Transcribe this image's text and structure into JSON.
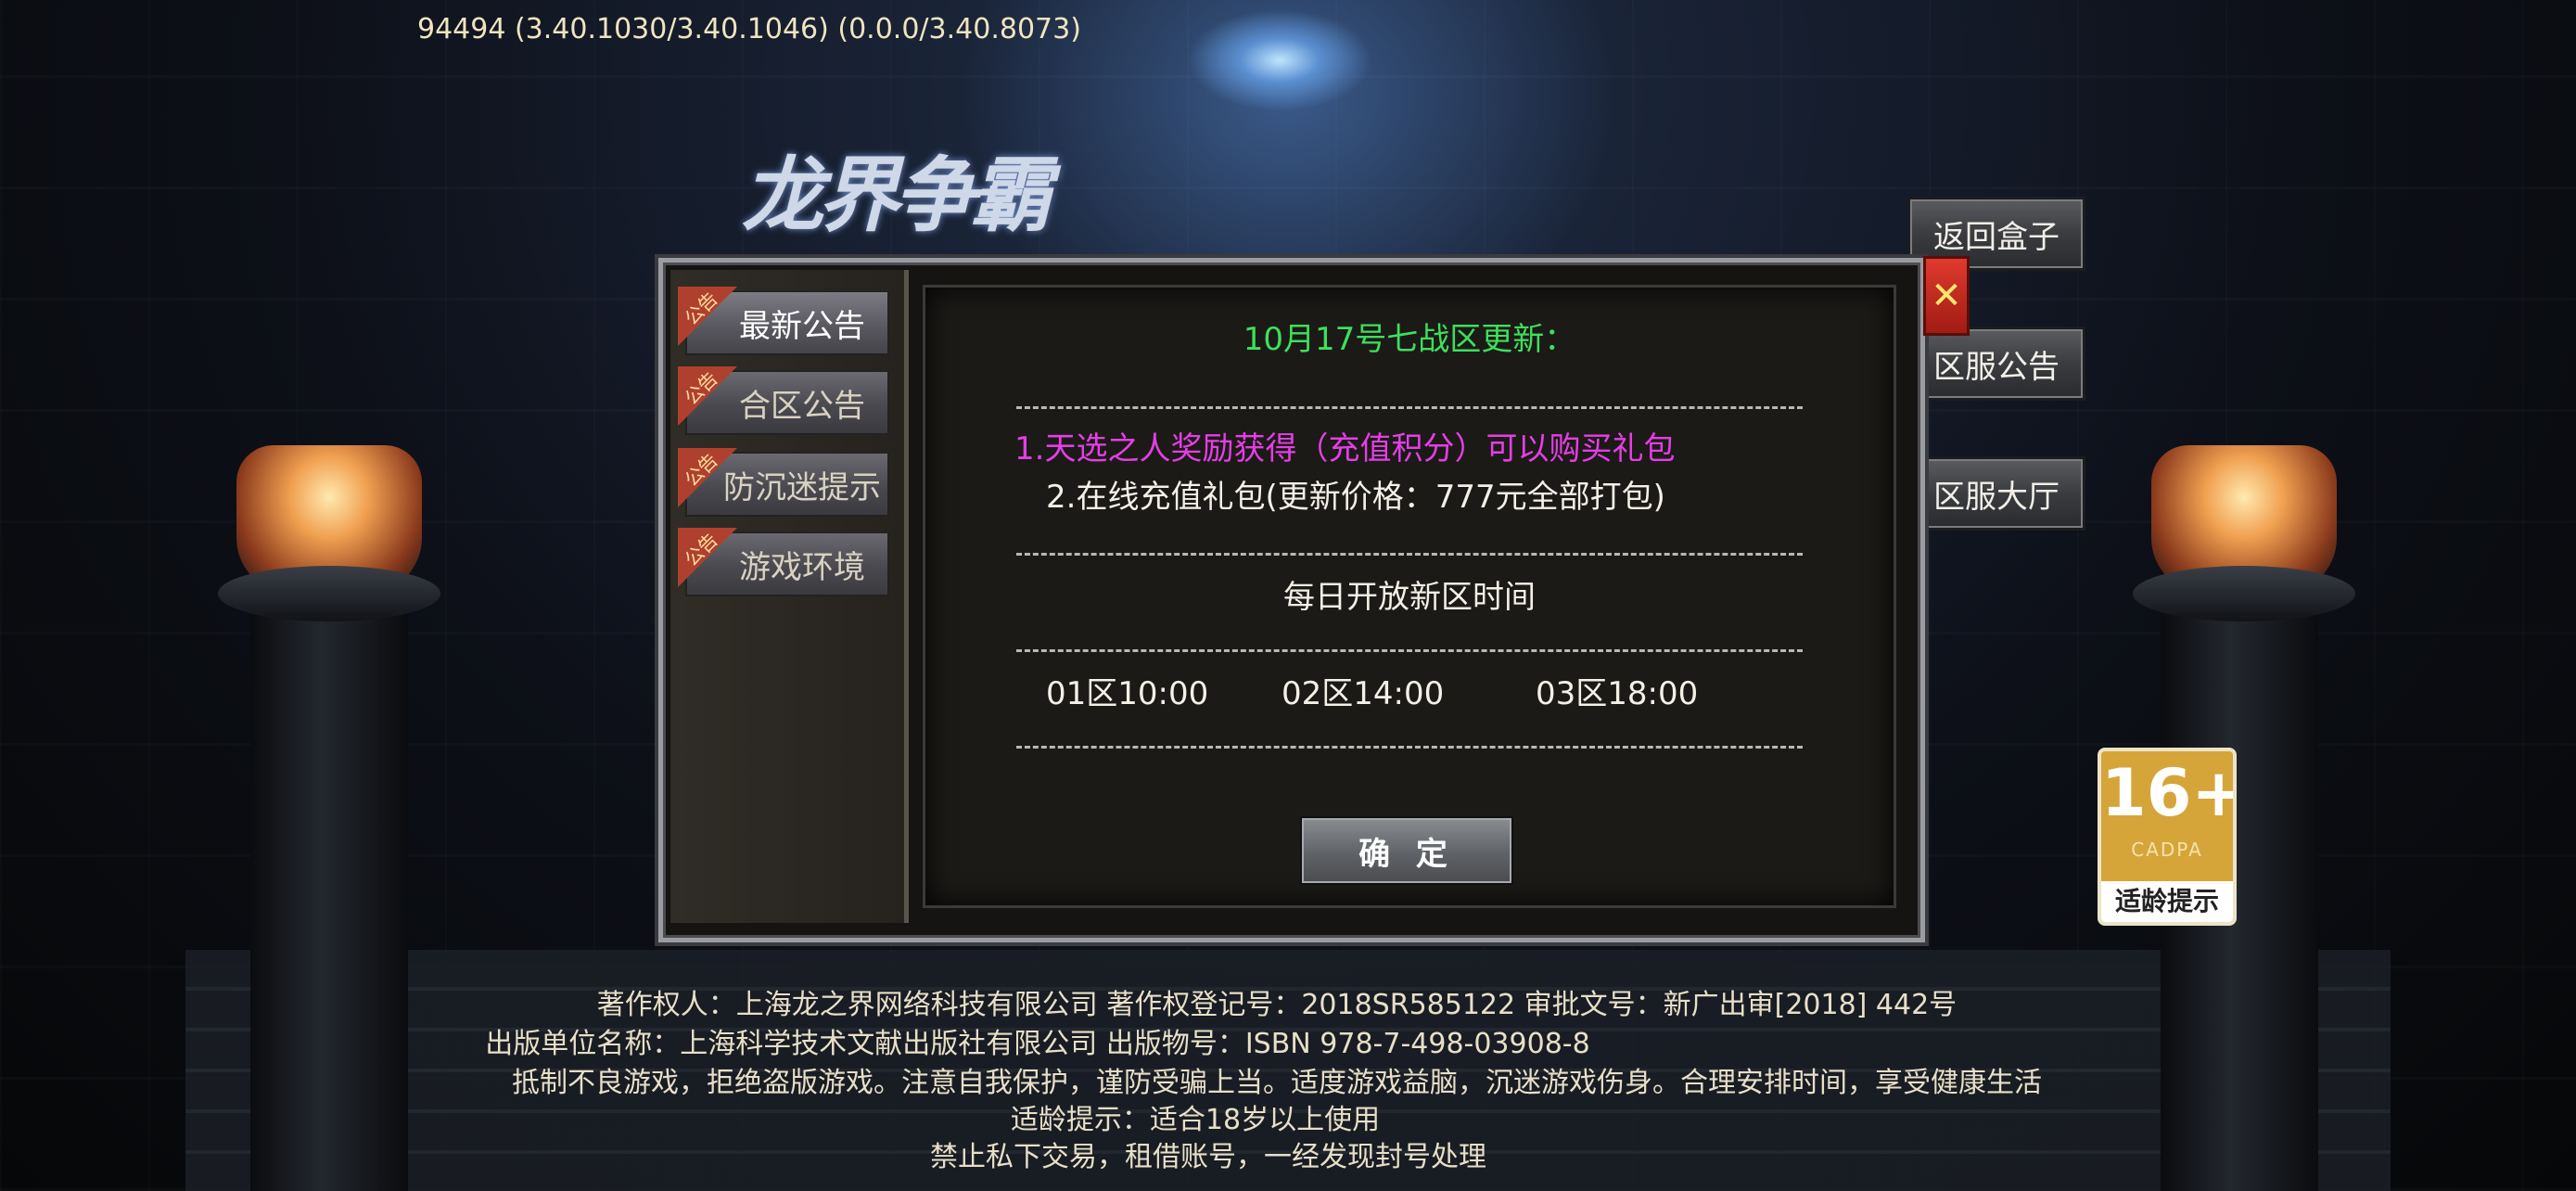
{
  "version": "94494 (3.40.1030/3.40.1046) (0.0.0/3.40.8073)",
  "logo_text": "龙界争霸",
  "side_buttons": {
    "back_to_box": "返回盒子",
    "server_notice": "区服公告",
    "server_hall": "区服大厅"
  },
  "dialog": {
    "ribbon_label": "公告",
    "tabs": [
      "最新公告",
      "合区公告",
      "防沉迷提示",
      "游戏环境"
    ],
    "title": "10月17号七战区更新：",
    "line1": "1.天选之人奖励获得（充值积分）可以购买礼包",
    "line2": "2.在线充值礼包(更新价格：777元全部打包)",
    "section_title": "每日开放新区时间",
    "zones": [
      "01区10:00",
      "02区14:00",
      "03区18:00"
    ],
    "ok_label": "确 定",
    "close_label": "✕"
  },
  "age_rating": {
    "number": "16+",
    "org": "CADPA",
    "tip": "适龄提示"
  },
  "footer": [
    "著作权人：上海龙之界网络科技有限公司 著作权登记号：2018SR585122 审批文号：新广出审[2018] 442号",
    "出版单位名称：上海科学技术文献出版社有限公司 出版物号：ISBN 978-7-498-03908-8",
    "抵制不良游戏，拒绝盗版游戏。注意自我保护，谨防受骗上当。适度游戏益脑，沉迷游戏伤身。合理安排时间，享受健康生活",
    "适龄提示：适合18岁以上使用",
    "禁止私下交易，租借账号，一经发现封号处理"
  ],
  "colors": {
    "title_green": "#3ee05a",
    "highlight_magenta": "#e53ee5",
    "close_red": "#c8281e",
    "age_gold": "#d6a53a"
  }
}
